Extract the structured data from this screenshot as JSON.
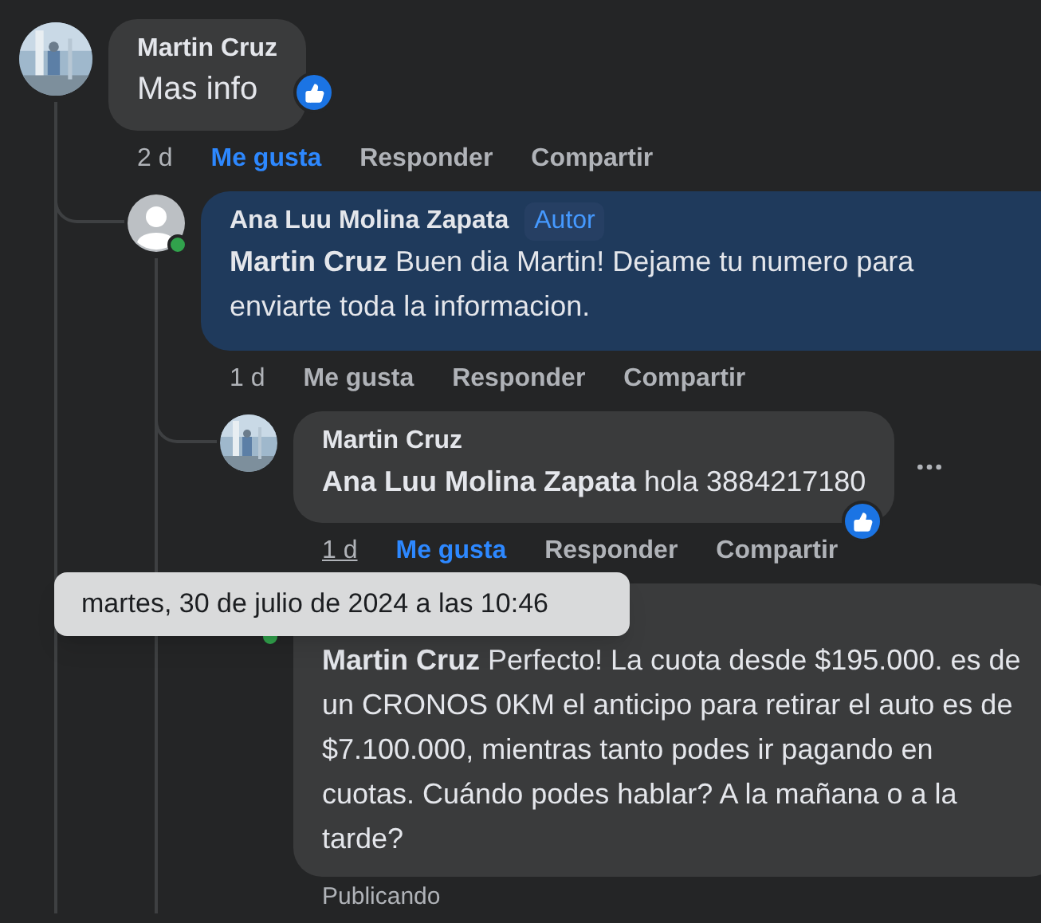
{
  "comments": [
    {
      "author": "Martin Cruz",
      "photo_avatar": true,
      "online": false,
      "highlighted": false,
      "text": "Mas info",
      "reaction": true,
      "time": "2 d",
      "liked": true,
      "actions": [
        "Me gusta",
        "Responder",
        "Compartir"
      ],
      "children": [
        {
          "author": "Ana Luu Molina Zapata",
          "badge": "Autor",
          "photo_avatar": false,
          "online": true,
          "highlighted": true,
          "text": "**Martin Cruz** Buen dia Martin! Dejame tu numero para enviarte toda la informacion.",
          "reaction": false,
          "time": "1 d",
          "liked": false,
          "actions": [
            "Me gusta",
            "Responder",
            "Compartir"
          ],
          "children": [
            {
              "author": "Martin Cruz",
              "photo_avatar": true,
              "online": false,
              "highlighted": false,
              "text": "**Ana Luu Molina Zapata** hola 3884217180",
              "reaction": true,
              "time": "1 d",
              "tooltip": "martes, 30 de julio de 2024 a las 10:46",
              "liked": true,
              "actions": [
                "Me gusta",
                "Responder",
                "Compartir"
              ],
              "more": true
            },
            {
              "online": true,
              "highlighted": false,
              "text": "**Martin Cruz** Perfecto! La cuota desde $195.000. es de un CRONOS 0KM el anticipo para retirar el auto es de $7.100.000, mientras tanto podes ir pagando en cuotas. Cuándo podes hablar? A la mañana o a la tarde?",
              "reaction": false,
              "status": "Publicando"
            }
          ]
        }
      ]
    }
  ]
}
